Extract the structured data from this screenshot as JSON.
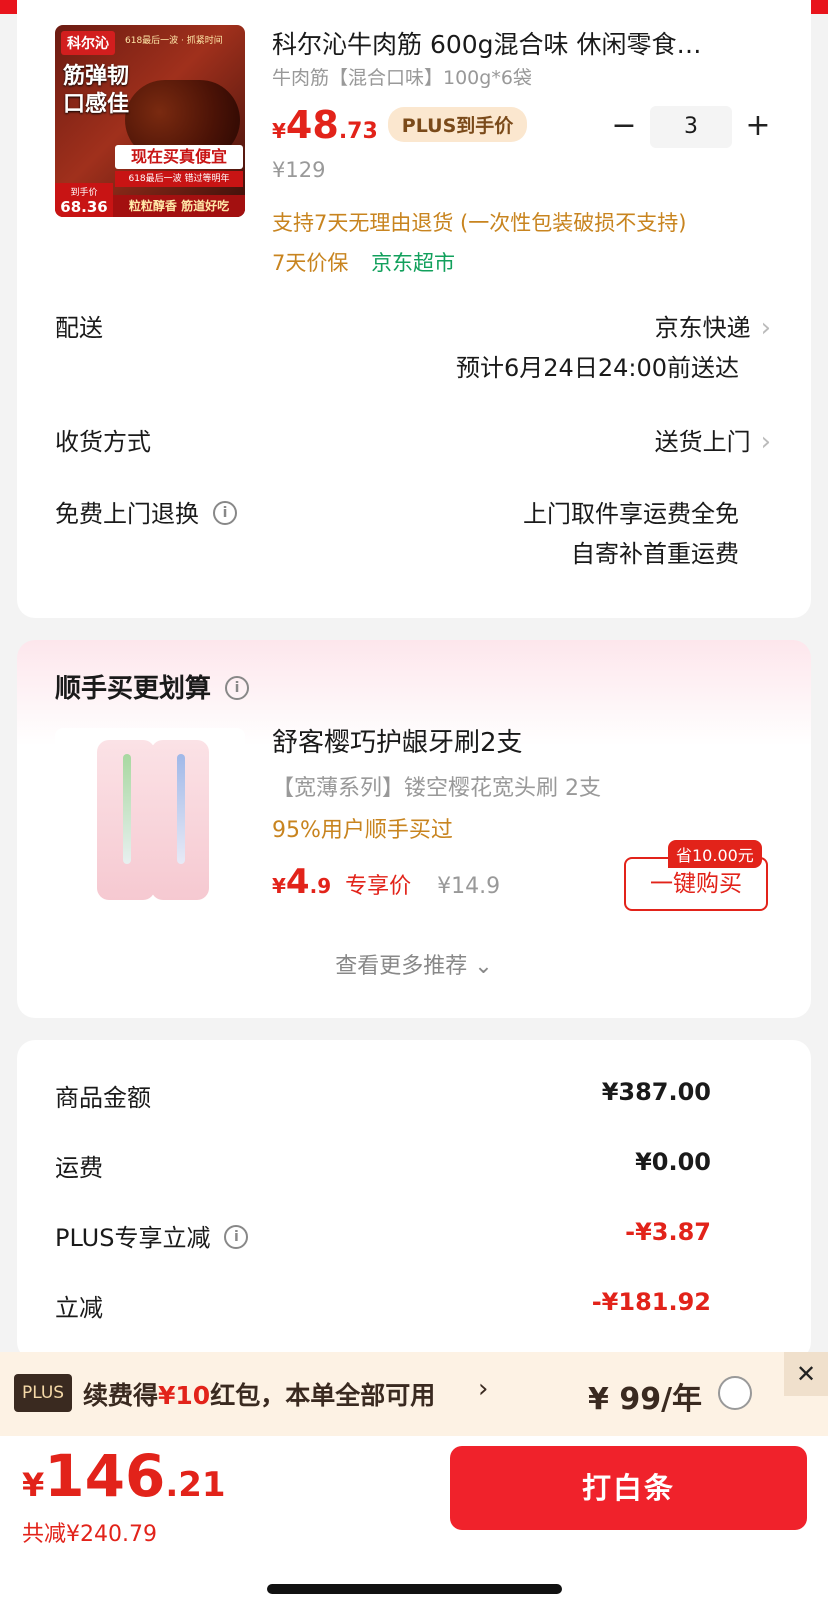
{
  "product": {
    "image": {
      "brand": "科尔沁",
      "top_strip": "618最后一波 · 抓紧时间",
      "slogan_line1": "筋弹韧",
      "slogan_line2": "口感佳",
      "buy_banner": "现在买真便宜",
      "small_tag": "618最后一波 错过等明年",
      "price_tag_label": "到手价",
      "price_tag_value": "68.36",
      "foot": "粒粒醇香 筋道好吃"
    },
    "title": "科尔沁牛肉筋 600g混合味 休闲零食…",
    "spec": "牛肉筋【混合口味】100g*6袋",
    "price_symbol": "¥",
    "price_int": "48",
    "price_dec": ".73",
    "plus_label": "PLUS到手价",
    "original_price": "¥129",
    "qty_minus": "−",
    "qty_value": "3",
    "qty_plus": "+",
    "return_note": "支持7天无理由退货 (一次性包装破损不支持)",
    "tag_price_protect": "7天价保",
    "tag_store": "京东超市"
  },
  "delivery": {
    "label": "配送",
    "value": "京东快递",
    "estimate": "预计6月24日24:00前送达"
  },
  "receive": {
    "label": "收货方式",
    "value": "送货上门"
  },
  "free_return": {
    "label": "免费上门退换",
    "line1": "上门取件享运费全免",
    "line2": "自寄补首重运费"
  },
  "recommend": {
    "title": "顺手买更划算",
    "name": "舒客樱巧护龈牙刷2支",
    "spec": "【宽薄系列】镂空樱花宽头刷 2支",
    "bought": "95%用户顺手买过",
    "price_symbol": "¥",
    "price_int": "4",
    "price_dec": ".9",
    "price_label": "专享价",
    "original_price": "¥14.9",
    "save_badge": "省10.00元",
    "buy_button": "一键购买",
    "more_link": "查看更多推荐 ⌄"
  },
  "summary": {
    "rows": [
      {
        "label": "商品金额",
        "value": "¥387.00"
      },
      {
        "label": "运费",
        "value": "¥0.00"
      },
      {
        "label": "PLUS专享立减",
        "value": "-¥3.87"
      },
      {
        "label": "立减",
        "value": "-¥181.92"
      }
    ]
  },
  "plus_renew": {
    "logo": "PLUS",
    "text_prefix": "续费得",
    "text_highlight": "¥10",
    "text_suffix": "红包，本单全部可用",
    "arrow": "›",
    "price": "¥ 99/年",
    "close": "✕"
  },
  "bottom": {
    "total_symbol": "¥",
    "total_int": "146",
    "total_dec": ".21",
    "total_saved": "共减¥240.79",
    "pay_button": "打白条"
  },
  "colors": {
    "accent_red": "#e2231a",
    "pay_button": "#f0222b",
    "gold_text": "#c8841f",
    "green_text": "#12a05c",
    "plus_bar_bg": "#fdf2e4"
  }
}
